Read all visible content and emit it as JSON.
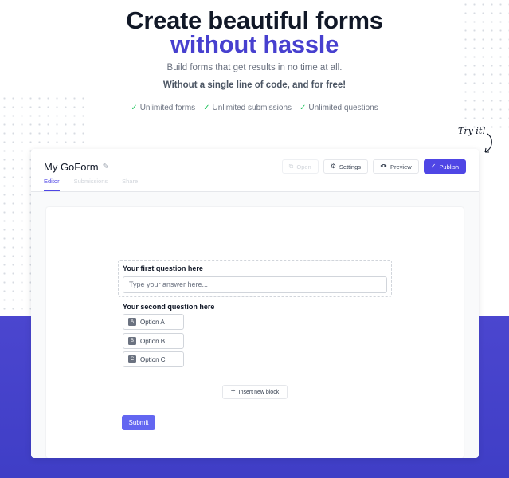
{
  "hero": {
    "title_line1": "Create beautiful forms",
    "title_line2": "without hassle",
    "subtitle": "Build forms that get results in no time at all.",
    "subtitle_bold": "Without a single line of code, and for free!",
    "features": [
      "Unlimited forms",
      "Unlimited submissions",
      "Unlimited questions"
    ],
    "try_it": "Try it!"
  },
  "app": {
    "form_name": "My GoForm",
    "tabs": [
      {
        "label": "Editor",
        "active": true
      },
      {
        "label": "Submissions",
        "active": false
      },
      {
        "label": "Share",
        "active": false
      }
    ],
    "toolbar": {
      "open_label": "Open",
      "settings_label": "Settings",
      "preview_label": "Preview",
      "publish_label": "Publish"
    },
    "form": {
      "question1": {
        "label": "Your first question here",
        "placeholder": "Type your answer here..."
      },
      "question2": {
        "label": "Your second question here",
        "options": [
          {
            "key": "A",
            "label": "Option A"
          },
          {
            "key": "B",
            "label": "Option B"
          },
          {
            "key": "C",
            "label": "Option C"
          }
        ]
      },
      "insert_block_label": "Insert new block",
      "submit_label": "Submit"
    }
  },
  "colors": {
    "accent": "#4f46e5",
    "title_accent": "#4740cf",
    "band": "#4b46cf",
    "check": "#22c55e"
  },
  "icons": {
    "check": "check-icon",
    "edit": "pencil-icon",
    "open": "external-link-icon",
    "settings": "gear-icon",
    "preview": "eye-icon",
    "publish": "check-icon",
    "insert": "plus-icon",
    "arrow": "curved-arrow-icon"
  }
}
